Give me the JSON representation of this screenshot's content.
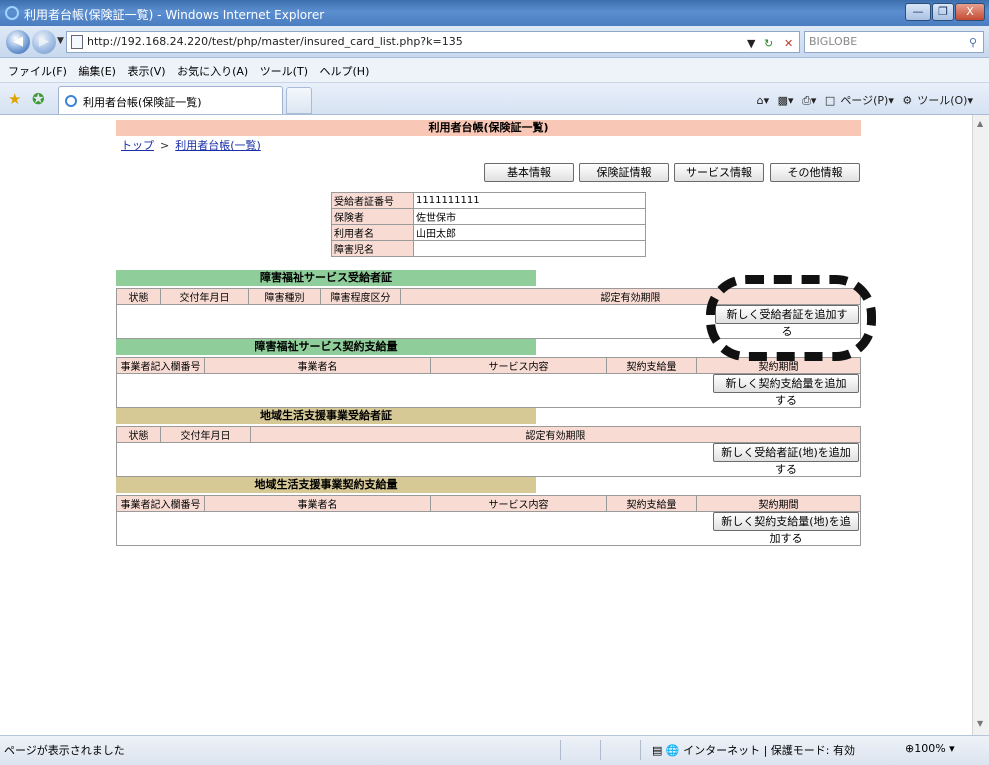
{
  "window": {
    "title": "利用者台帳(保険証一覧) - Windows Internet Explorer",
    "minimize_icon": "minimize-icon",
    "maximize_icon": "maximize-icon",
    "close_label": "X"
  },
  "address_bar": {
    "url": "http://192.168.24.220/test/php/master/insured_card_list.php?k=135",
    "search_placeholder": "BIGLOBE"
  },
  "menu": {
    "items": [
      "ファイル(F)",
      "編集(E)",
      "表示(V)",
      "お気に入り(A)",
      "ツール(T)",
      "ヘルプ(H)"
    ]
  },
  "tab_bar": {
    "active_tab": "利用者台帳(保険証一覧)",
    "page_label": "ページ(P)",
    "tools_label": "ツール(O)"
  },
  "page": {
    "title": "利用者台帳(保険証一覧)",
    "breadcrumb": {
      "home": "トップ",
      "separator": ">",
      "current": "利用者台帳(一覧)"
    },
    "tabs": [
      "基本情報",
      "保険証情報",
      "サービス情報",
      "その他情報"
    ],
    "info": [
      {
        "label": "受給者証番号",
        "value": "1111111111"
      },
      {
        "label": "保険者",
        "value": "佐世保市"
      },
      {
        "label": "利用者名",
        "value": "山田太郎"
      },
      {
        "label": "障害児名",
        "value": ""
      }
    ],
    "sections": [
      {
        "title": "障害福祉サービス受給者証",
        "columns": [
          "状態",
          "交付年月日",
          "障害種別",
          "障害程度区分",
          "認定有効期限"
        ],
        "button": "新しく受給者証を追加する"
      },
      {
        "title": "障害福祉サービス契約支給量",
        "columns": [
          "事業者記入欄番号",
          "事業者名",
          "サービス内容",
          "契約支給量",
          "契約期間"
        ],
        "button": "新しく契約支給量を追加する"
      },
      {
        "title": "地域生活支援事業受給者証",
        "columns": [
          "状態",
          "交付年月日",
          "認定有効期限"
        ],
        "button": "新しく受給者証(地)を追加する"
      },
      {
        "title": "地域生活支援事業契約支給量",
        "columns": [
          "事業者記入欄番号",
          "事業者名",
          "サービス内容",
          "契約支給量",
          "契約期間"
        ],
        "button": "新しく契約支給量(地)を追加する"
      }
    ]
  },
  "status_bar": {
    "message": "ページが表示されました",
    "zone": "インターネット | 保護モード: 有効",
    "zoom": "100%"
  }
}
